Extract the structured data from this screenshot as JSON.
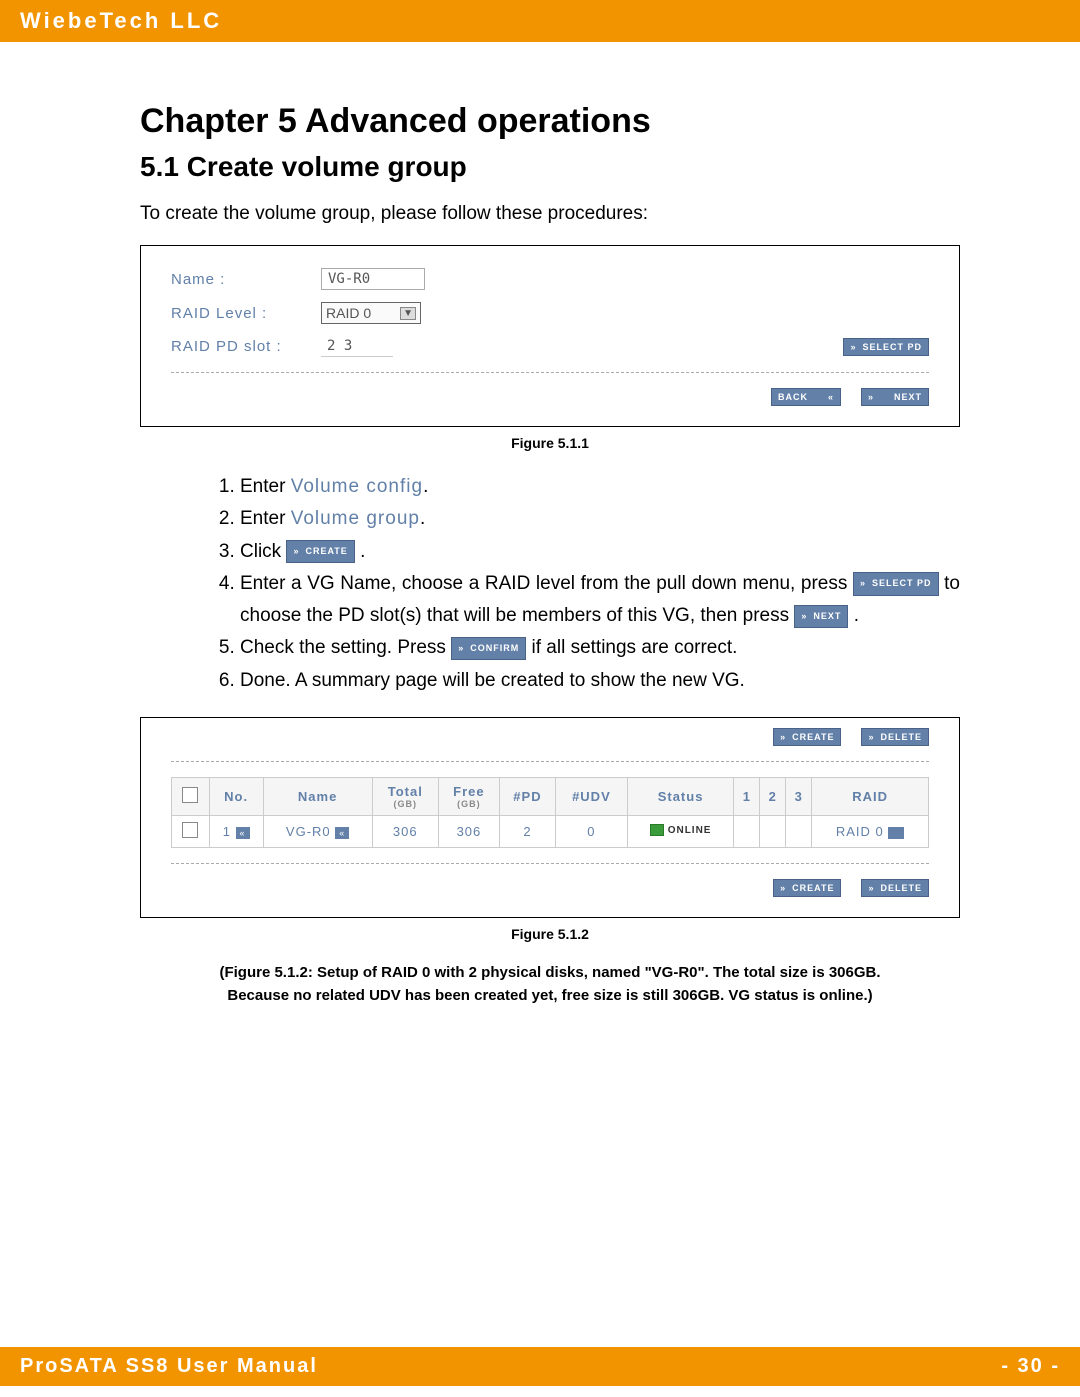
{
  "header": {
    "company": "WiebeTech LLC"
  },
  "footer": {
    "title": "ProSATA SS8 User Manual",
    "page": "- 30 -"
  },
  "chapter": {
    "title": "Chapter 5 Advanced operations"
  },
  "section": {
    "title": "5.1   Create volume group"
  },
  "intro": "To create the volume group, please follow these procedures:",
  "fig1": {
    "name_label": "Name :",
    "name_value": "VG-R0",
    "raid_label": "RAID Level :",
    "raid_value": "RAID 0",
    "slot_label": "RAID PD slot :",
    "slot_value": "2 3",
    "select_pd_btn": "SELECT PD",
    "back_btn": "BACK",
    "next_btn": "NEXT",
    "caption": "Figure 5.1.1"
  },
  "steps": {
    "s1_a": "Enter ",
    "s1_b": "Volume config",
    "s1_c": ".",
    "s2_a": "Enter ",
    "s2_b": "Volume group",
    "s2_c": ".",
    "s3_a": "Click  ",
    "s3_btn": "CREATE",
    "s3_b": " .",
    "s4_a": "Enter a VG Name, choose a RAID level from the pull down menu, press ",
    "s4_btn1": "SELECT PD",
    "s4_b": " to choose the PD slot(s) that will be members of this VG, then press ",
    "s4_btn2": "NEXT",
    "s4_c": " .",
    "s5_a": "Check the setting. Press ",
    "s5_btn": "CONFIRM",
    "s5_b": " if all settings are correct.",
    "s6": "Done. A summary page will be created to show the new VG."
  },
  "fig2": {
    "create_btn": "CREATE",
    "delete_btn": "DELETE",
    "headers": {
      "no": "No.",
      "name": "Name",
      "total": "Total",
      "total_sub": "(GB)",
      "free": "Free",
      "free_sub": "(GB)",
      "pd": "#PD",
      "udv": "#UDV",
      "status": "Status",
      "c1": "1",
      "c2": "2",
      "c3": "3",
      "raid": "RAID"
    },
    "row": {
      "no": "1",
      "name": "VG-R0",
      "total": "306",
      "free": "306",
      "pd": "2",
      "udv": "0",
      "status": "ONLINE",
      "raid": "RAID 0"
    },
    "caption": "Figure 5.1.2"
  },
  "desc": "(Figure 5.1.2: Setup of RAID 0 with 2 physical disks, named \"VG-R0\". The total size is 306GB. Because no related UDV has been created yet, free size is still 306GB. VG status is online.)"
}
